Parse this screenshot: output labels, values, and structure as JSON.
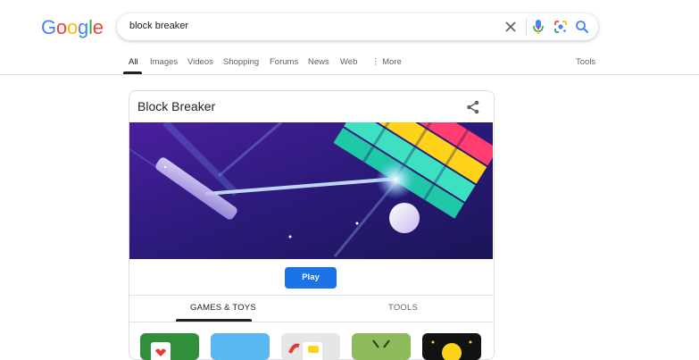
{
  "logo": {
    "letters": [
      "G",
      "o",
      "o",
      "g",
      "l",
      "e"
    ],
    "colors": [
      "#4285f4",
      "#ea4335",
      "#fbbc05",
      "#4285f4",
      "#34a853",
      "#ea4335"
    ]
  },
  "search": {
    "query": "block breaker"
  },
  "icons": {
    "clear": "close-icon",
    "mic": "microphone-icon",
    "lens": "lens-icon",
    "search": "search-icon",
    "share": "share-icon"
  },
  "tabs": [
    {
      "label": "All",
      "active": true
    },
    {
      "label": "Images"
    },
    {
      "label": "Videos"
    },
    {
      "label": "Shopping"
    },
    {
      "label": "Forums"
    },
    {
      "label": "News"
    },
    {
      "label": "Web"
    },
    {
      "label": "⋮ More"
    }
  ],
  "tools_label": "Tools",
  "card": {
    "title": "Block Breaker",
    "play_label": "Play",
    "tabs": [
      "GAMES & TOYS",
      "TOOLS"
    ]
  },
  "colors": {
    "accent": "#1a73e8"
  }
}
